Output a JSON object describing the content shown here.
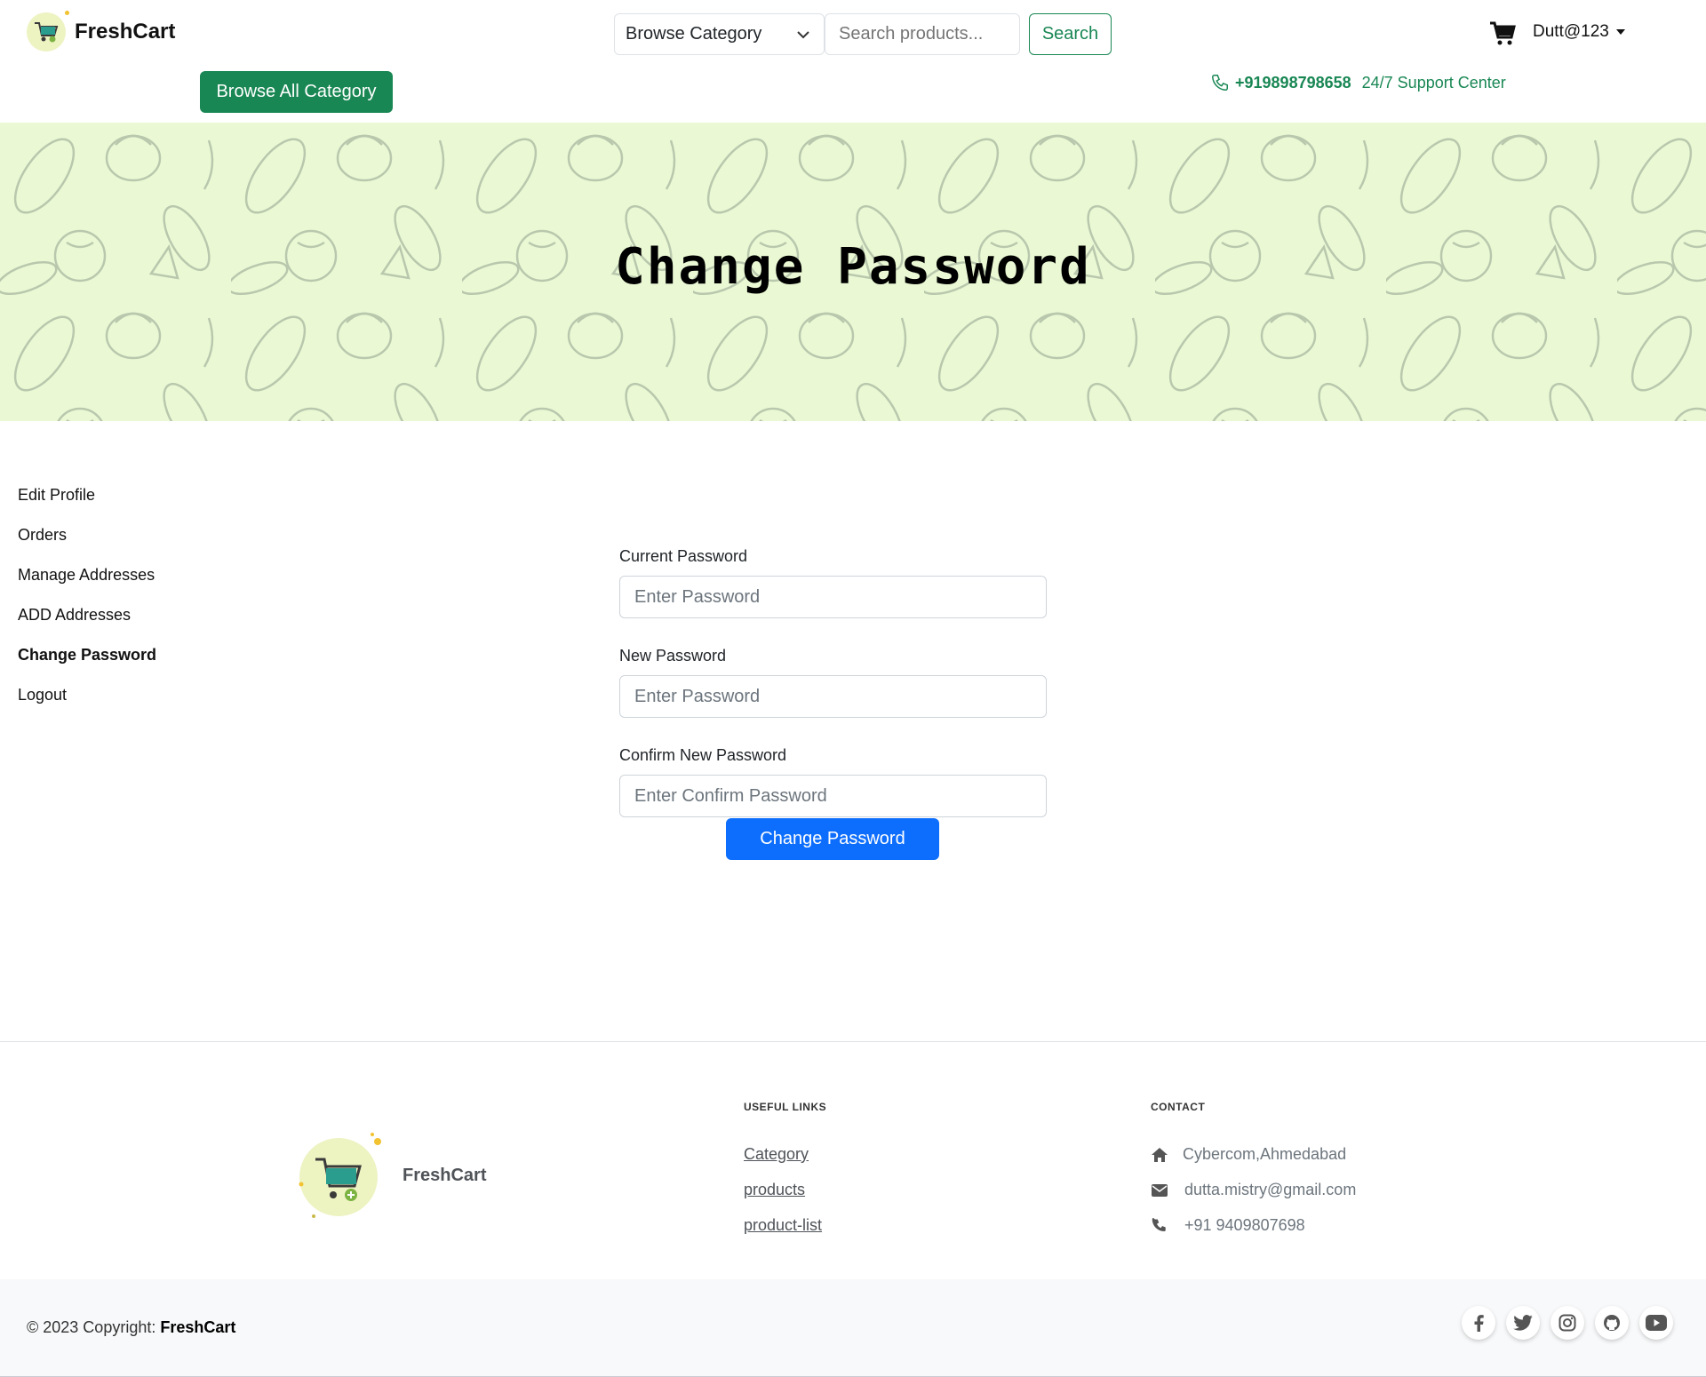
{
  "brand": {
    "name": "FreshCart"
  },
  "header": {
    "category_select": "Browse Category",
    "search_placeholder": "Search products...",
    "search_button": "Search",
    "user_name": "Dutt@123",
    "browse_all_button": "Browse All Category",
    "support_phone": "+919898798658",
    "support_text": "24/7 Support Center"
  },
  "hero": {
    "title": "Change Password"
  },
  "sidebar": {
    "items": [
      {
        "label": "Edit Profile"
      },
      {
        "label": "Orders"
      },
      {
        "label": "Manage Addresses"
      },
      {
        "label": "ADD Addresses"
      },
      {
        "label": "Change Password",
        "active": true
      },
      {
        "label": "Logout"
      }
    ]
  },
  "form": {
    "current_label": "Current Password",
    "current_placeholder": "Enter Password",
    "new_label": "New Password",
    "new_placeholder": "Enter Password",
    "confirm_label": "Confirm New Password",
    "confirm_placeholder": "Enter Confirm Password",
    "submit_button": "Change Password"
  },
  "footer": {
    "brand": "FreshCart",
    "useful_links_title": "USEFUL LINKS",
    "links": [
      "Category",
      "products",
      "product-list"
    ],
    "contact_title": "CONTACT",
    "address": "Cybercom,Ahmedabad",
    "email": "dutta.mistry@gmail.com",
    "phone": "+91 9409807698",
    "copyright_prefix": "© 2023 Copyright: ",
    "copyright_brand": "FreshCart",
    "socials": [
      "facebook-icon",
      "twitter-icon",
      "instagram-icon",
      "github-icon",
      "youtube-icon"
    ]
  },
  "colors": {
    "primary_green": "#198754",
    "primary_blue": "#0d6efd",
    "hero_bg": "#eaf9d4"
  }
}
